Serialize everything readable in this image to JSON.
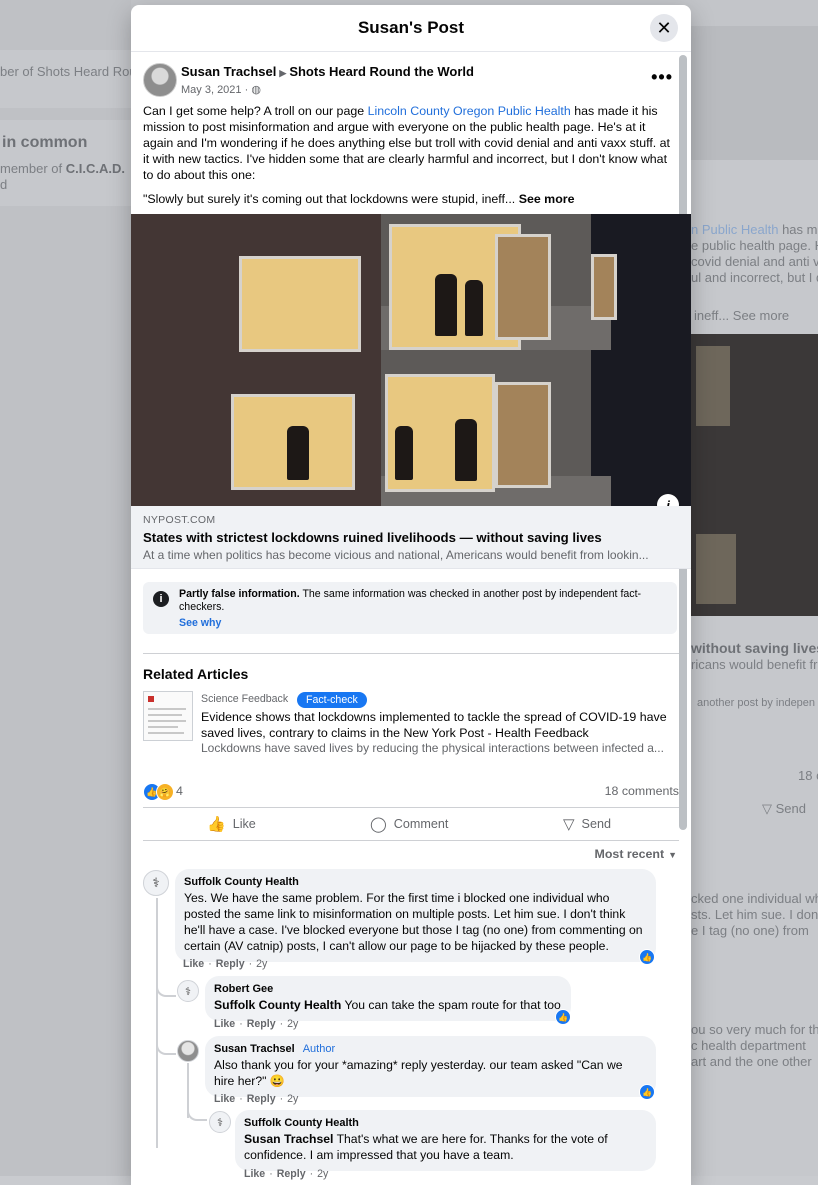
{
  "background": {
    "left_item_1": "ber of Shots Heard Rou",
    "left_heading": "in common",
    "left_item_2": "member of",
    "left_item_2_group": "C.I.C.A.D.",
    "left_item_3": "d",
    "right_link": "n Public Health",
    "right_text_1": "has ma",
    "right_text_2": "e public health page.  H",
    "right_text_3": "covid denial and anti v",
    "right_text_4": "ul and incorrect, but I d",
    "right_see_more": "ineff... See more",
    "right_preview_title": "without saving lives",
    "right_preview_desc": "ricans would benefit fro",
    "right_fc": "another post by indepen",
    "right_count": "18 c",
    "right_send": "Send",
    "right_cm_1": "cked one individual wh",
    "right_cm_2": "sts. Let him sue. I don't",
    "right_cm_3": "e I tag (no one) from",
    "right_cm_4": "ou so very much for the",
    "right_cm_5": "c health department",
    "right_cm_6": "art and the one other"
  },
  "modal": {
    "title": "Susan's Post",
    "close_label": "✕"
  },
  "post": {
    "author": "Susan Trachsel",
    "arrow": "▶",
    "group": "Shots Heard Round the World",
    "date": "May 3, 2021 · ",
    "privacy_icon": "◍",
    "more": "•••",
    "text_before_link": "Can I get some help? A troll on our page ",
    "link_text": "Lincoln County Oregon Public Health",
    "text_after_link": " has made it his mission to post misinformation and argue with everyone on the public health page.  He's at it again and I'm wondering if he does anything else but troll with covid denial and anti vaxx stuff. at it with new tactics.  I've hidden some that are clearly harmful and incorrect, but I don't know what to do about this one:",
    "quote": "\"Slowly but surely it's coming out that lockdowns were stupid, ineff... ",
    "see_more": "See more"
  },
  "link_preview": {
    "domain": "NYPOST.COM",
    "title": "States with strictest lockdowns ruined livelihoods — without saving lives",
    "description": "At a time when politics has become vicious and national, Americans would benefit from lookin...",
    "info_icon": "i"
  },
  "fact_check": {
    "icon": "i",
    "bold": "Partly false information.",
    "text": " The same information was checked in another post by independent fact-checkers.",
    "see_why": "See why"
  },
  "related": {
    "heading": "Related Articles",
    "source": "Science Feedback",
    "badge": "Fact-check",
    "title": "Evidence shows that lockdowns implemented to tackle the spread of COVID-19 have saved lives, contrary to claims in the New York Post - Health Feedback",
    "description": "Lockdowns have saved lives by reducing the physical interactions between infected a..."
  },
  "reactions": {
    "like_icon": "👍",
    "care_icon": "🤗",
    "count": "4",
    "comments": "18 comments"
  },
  "actions": {
    "like": "Like",
    "like_icon": "👍",
    "comment": "Comment",
    "comment_icon": "◯",
    "send": "Send",
    "send_icon": "▽"
  },
  "sort": {
    "label": "Most recent",
    "caret": "▼"
  },
  "comments": [
    {
      "name": "Suffolk County Health",
      "text": "Yes. We have the same problem. For the first time i blocked one individual who posted the same link to misinformation on multiple posts. Let him sue. I don't think he'll have a case. I've blocked everyone but those I tag (no one) from commenting on certain (AV catnip) posts, I can't allow our page to be hijacked by these people.",
      "like": "Like",
      "reply": "Reply",
      "time": "2y"
    },
    {
      "name": "Robert Gee",
      "mention": "Suffolk County Health",
      "text": " You can take the spam route for that too",
      "like": "Like",
      "reply": "Reply",
      "time": "2y"
    },
    {
      "name": "Susan Trachsel",
      "author_tag": "Author",
      "text": "Also thank you for your *amazing* reply yesterday. our team asked \"Can we hire her?\" 😀",
      "like": "Like",
      "reply": "Reply",
      "time": "2y"
    },
    {
      "name": "Suffolk County Health",
      "mention": "Susan Trachsel",
      "text": " That's what we are here for. Thanks for the vote of confidence. I am impressed that you have a team.",
      "like": "Like",
      "reply": "Reply",
      "time": "2y"
    }
  ],
  "comment_like_icon": "👍",
  "avatar_glyph": "⚕"
}
